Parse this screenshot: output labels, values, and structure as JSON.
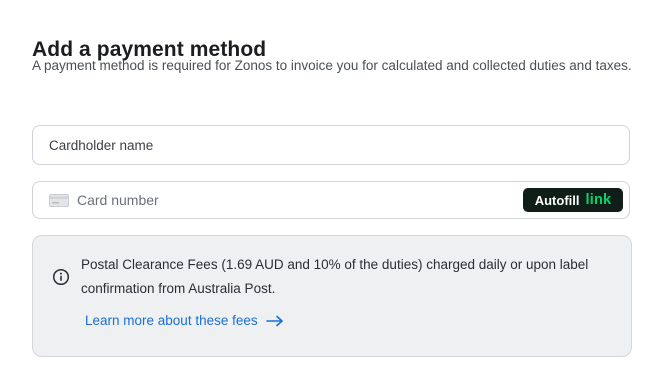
{
  "header": {
    "title": "Add a payment method",
    "description": "A payment method is required for Zonos to invoice you for calculated and collected duties and taxes."
  },
  "form": {
    "cardholder_name": {
      "placeholder": "Cardholder name",
      "value": ""
    },
    "card_number": {
      "placeholder": "Card number",
      "value": "",
      "icon": "credit-card-icon"
    },
    "autofill": {
      "label": "Autofill",
      "brand": "link",
      "background_color": "#0f1f17",
      "brand_color": "#00d66f"
    }
  },
  "notice": {
    "icon": "info-icon",
    "text": "Postal Clearance Fees (1.69 AUD and 10% of the duties) charged daily or upon label confirmation from Australia Post.",
    "link_label": "Learn more about these fees",
    "link_icon": "arrow-right-icon",
    "link_color": "#1a6fd1"
  }
}
